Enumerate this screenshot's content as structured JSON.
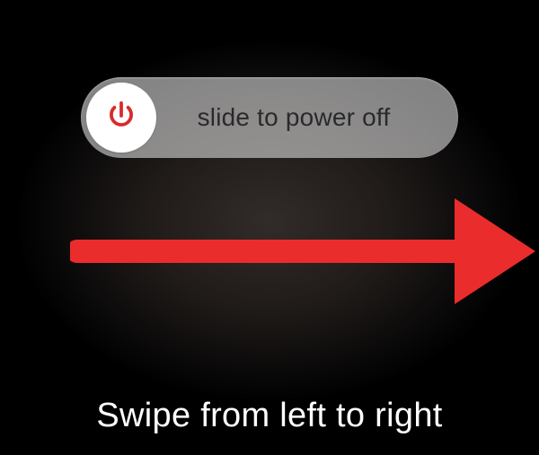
{
  "slider": {
    "label": "slide to power off",
    "icon_name": "power-icon",
    "icon_color": "#d92b2b"
  },
  "annotation": {
    "arrow_color": "#ea2c2c"
  },
  "caption": {
    "text": "Swipe from left to right"
  }
}
